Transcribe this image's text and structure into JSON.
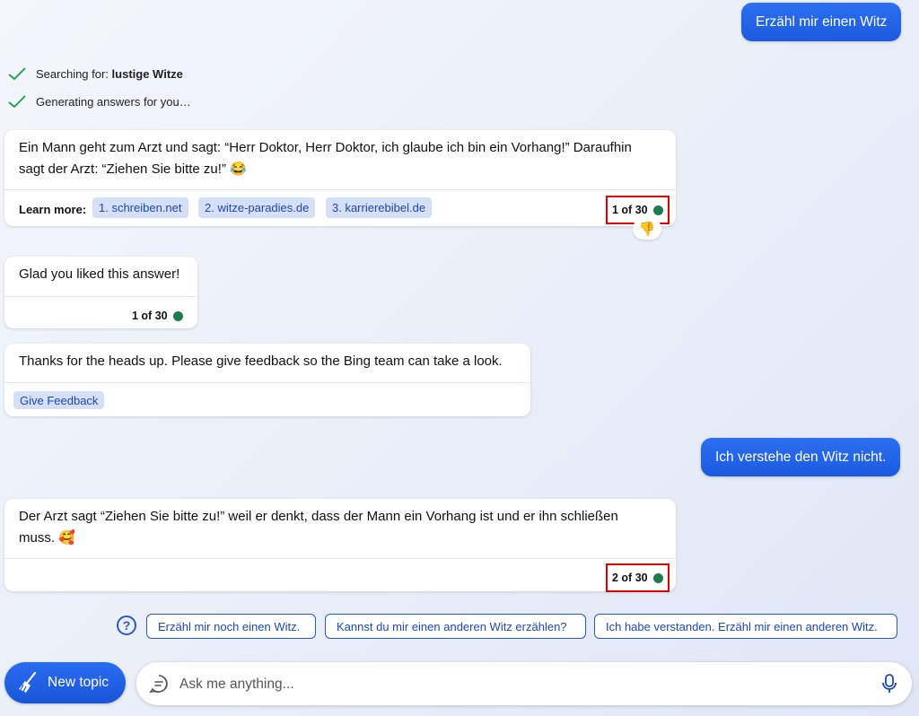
{
  "messages": {
    "user_1": "Erzähl mir einen Witz",
    "status_searching_prefix": "Searching for: ",
    "status_searching_query": "lustige Witze",
    "status_generating": "Generating answers for you…",
    "bot_1": {
      "text": "Ein Mann geht zum Arzt und sagt: “Herr Doktor, Herr Doktor, ich glaube ich bin ein Vorhang!” Daraufhin sagt der Arzt: “Ziehen Sie bitte zu!” 😂",
      "learn_more_label": "Learn more:",
      "sources": [
        "1. schreiben.net",
        "2. witze-paradies.de",
        "3. karrierebibel.de"
      ],
      "count": "1 of 30",
      "reaction": "👎"
    },
    "bot_2": {
      "text": "Glad you liked this answer!",
      "count": "1 of 30"
    },
    "bot_3": {
      "text": "Thanks for the heads up. Please give feedback so the Bing team can take a look.",
      "button": "Give Feedback"
    },
    "user_2": "Ich verstehe den Witz nicht.",
    "bot_4": {
      "text": "Der Arzt sagt “Ziehen Sie bitte zu!” weil er denkt, dass der Mann ein Vorhang ist und er ihn schließen muss. 🥰",
      "count": "2 of 30"
    }
  },
  "suggestions": [
    "Erzähl mir noch einen Witz.",
    "Kannst du mir einen anderen Witz erzählen?",
    "Ich habe verstanden. Erzähl mir einen anderen Witz."
  ],
  "input": {
    "new_topic_label": "New topic",
    "placeholder": "Ask me anything..."
  },
  "colors": {
    "accent": "#1b5fe0",
    "highlight_box": "#e00000",
    "status_dot": "#1e7b4a",
    "check": "#1e9e4a"
  },
  "icons": [
    "check-icon",
    "help-icon",
    "broom-icon",
    "chat-bubble-icon",
    "microphone-icon"
  ]
}
